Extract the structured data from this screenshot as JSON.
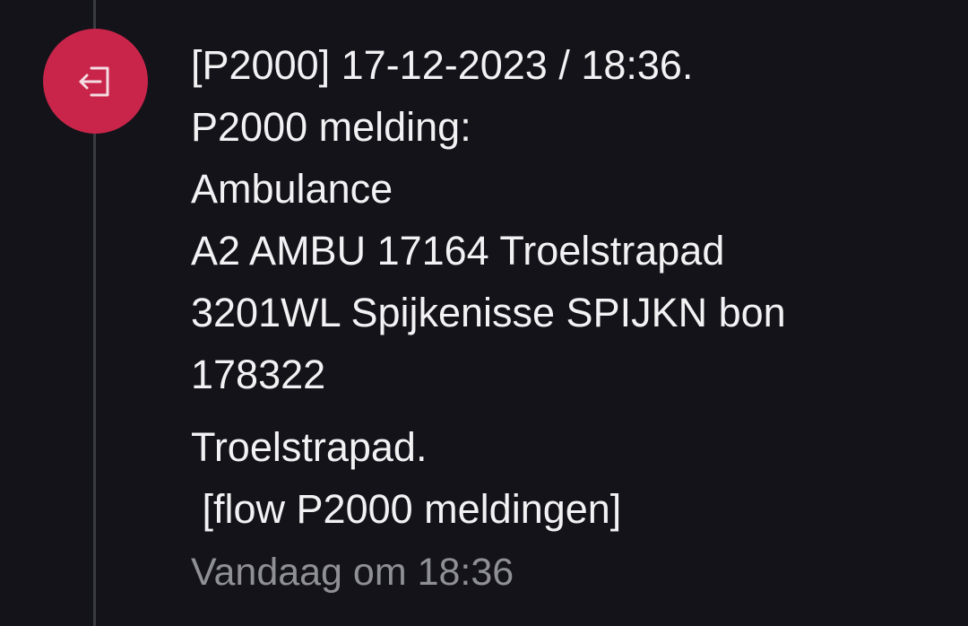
{
  "event": {
    "icon": "logout-arrow-icon",
    "badge_color": "#c9254a"
  },
  "message": {
    "lines": [
      "[P2000] 17-12-2023 / 18:36.",
      "P2000 melding:",
      "Ambulance",
      "A2 AMBU 17164 Troelstrapad",
      "3201WL Spijkenisse SPIJKN bon",
      "178322"
    ],
    "location_line": "Troelstrapad.",
    "flow_line": " [flow P2000 meldingen]",
    "timestamp": "Vandaag om 18:36"
  },
  "colors": {
    "background": "#131319",
    "timeline": "#3a3a42",
    "text": "#f2f2f4",
    "muted_text": "#8f8f96"
  }
}
